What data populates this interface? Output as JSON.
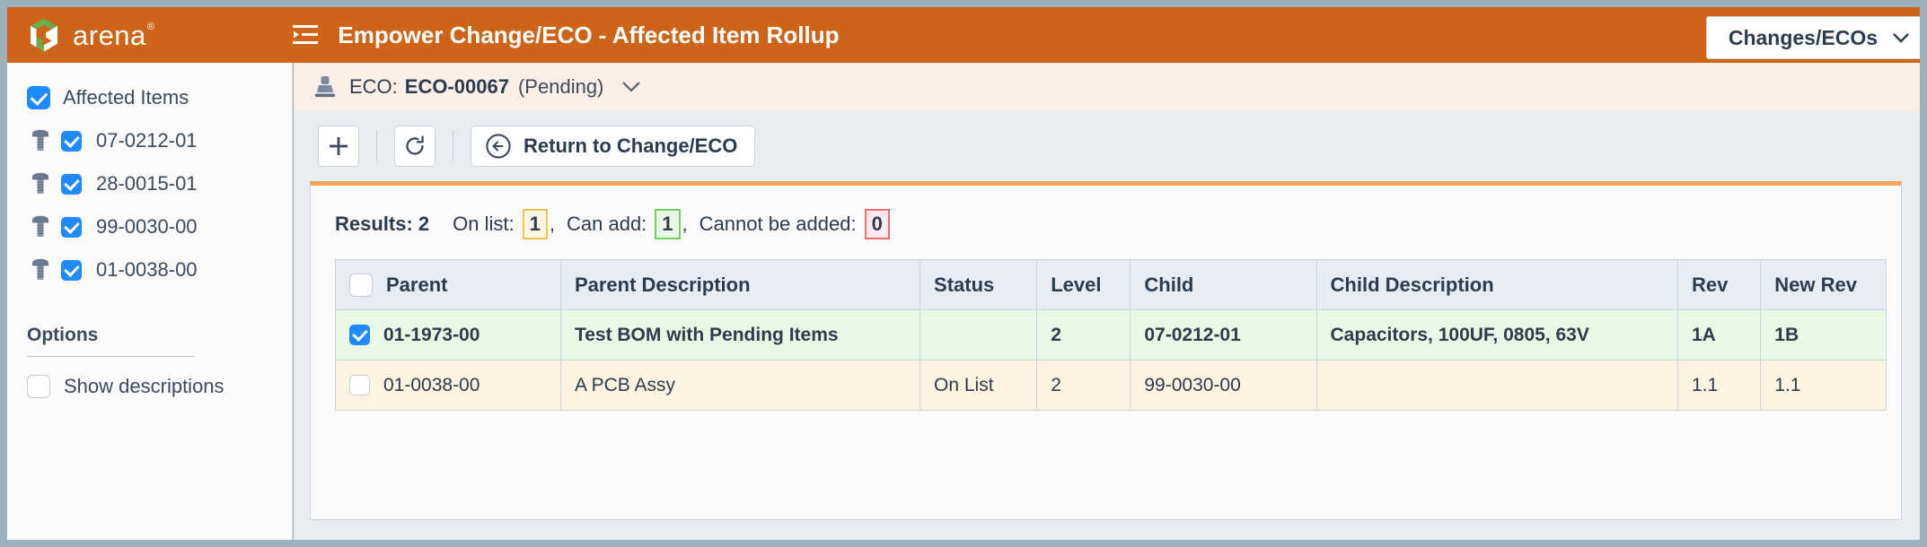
{
  "header": {
    "brand_name": "arena",
    "brand_reg": "®",
    "collapse_icon": "collapse-sidebar-icon",
    "title": "Empower Change/ECO - Affected Item Rollup",
    "context_select": {
      "label": "Changes/ECOs",
      "chevron": "chevron-down-icon"
    },
    "accent_color": "#cd6417"
  },
  "sidebar": {
    "root": {
      "label": "Affected Items",
      "checked": true
    },
    "items": [
      {
        "label": "07-0212-01",
        "checked": true,
        "icon": "screw-icon"
      },
      {
        "label": "28-0015-01",
        "checked": true,
        "icon": "screw-icon"
      },
      {
        "label": "99-0030-00",
        "checked": true,
        "icon": "screw-icon"
      },
      {
        "label": "01-0038-00",
        "checked": true,
        "icon": "screw-icon"
      }
    ],
    "options": {
      "heading": "Options",
      "show_descriptions": {
        "label": "Show descriptions",
        "checked": false
      }
    }
  },
  "breadcrumb": {
    "icon": "stamp-icon",
    "prefix": "ECO:",
    "number": "ECO-00067",
    "status": "(Pending)",
    "chevron": "chevron-down-icon"
  },
  "toolbar": {
    "add_label": "+",
    "refresh_icon": "refresh-icon",
    "return_label": "Return to Change/ECO",
    "return_icon": "arrow-left-circle-icon"
  },
  "results": {
    "results_label": "Results: 2",
    "on_list_label": "On list:",
    "on_list_count": "1",
    "can_add_label": "Can add:",
    "can_add_count": "1",
    "cannot_label": "Cannot be added:",
    "cannot_count": "0",
    "separator": ",",
    "colors": {
      "on_list": "#f2c14e",
      "can_add": "#6ed45c",
      "cannot": "#f07070"
    }
  },
  "table": {
    "columns": [
      "Parent",
      "Parent Description",
      "Status",
      "Level",
      "Child",
      "Child Description",
      "Rev",
      "New Rev"
    ],
    "header_checkbox_checked": false,
    "rows": [
      {
        "checked": true,
        "parent": "01-1973-00",
        "parent_description": "Test BOM with Pending Items",
        "status": "",
        "level": "2",
        "child": "07-0212-01",
        "child_description": "Capacitors, 100UF, 0805, 63V",
        "rev": "1A",
        "new_rev": "1B",
        "state": "can-add"
      },
      {
        "checked": false,
        "parent": "01-0038-00",
        "parent_description": "A PCB Assy",
        "status": "On List",
        "level": "2",
        "child": "99-0030-00",
        "child_description": "",
        "rev": "1.1",
        "new_rev": "1.1",
        "state": "on-list"
      }
    ]
  }
}
